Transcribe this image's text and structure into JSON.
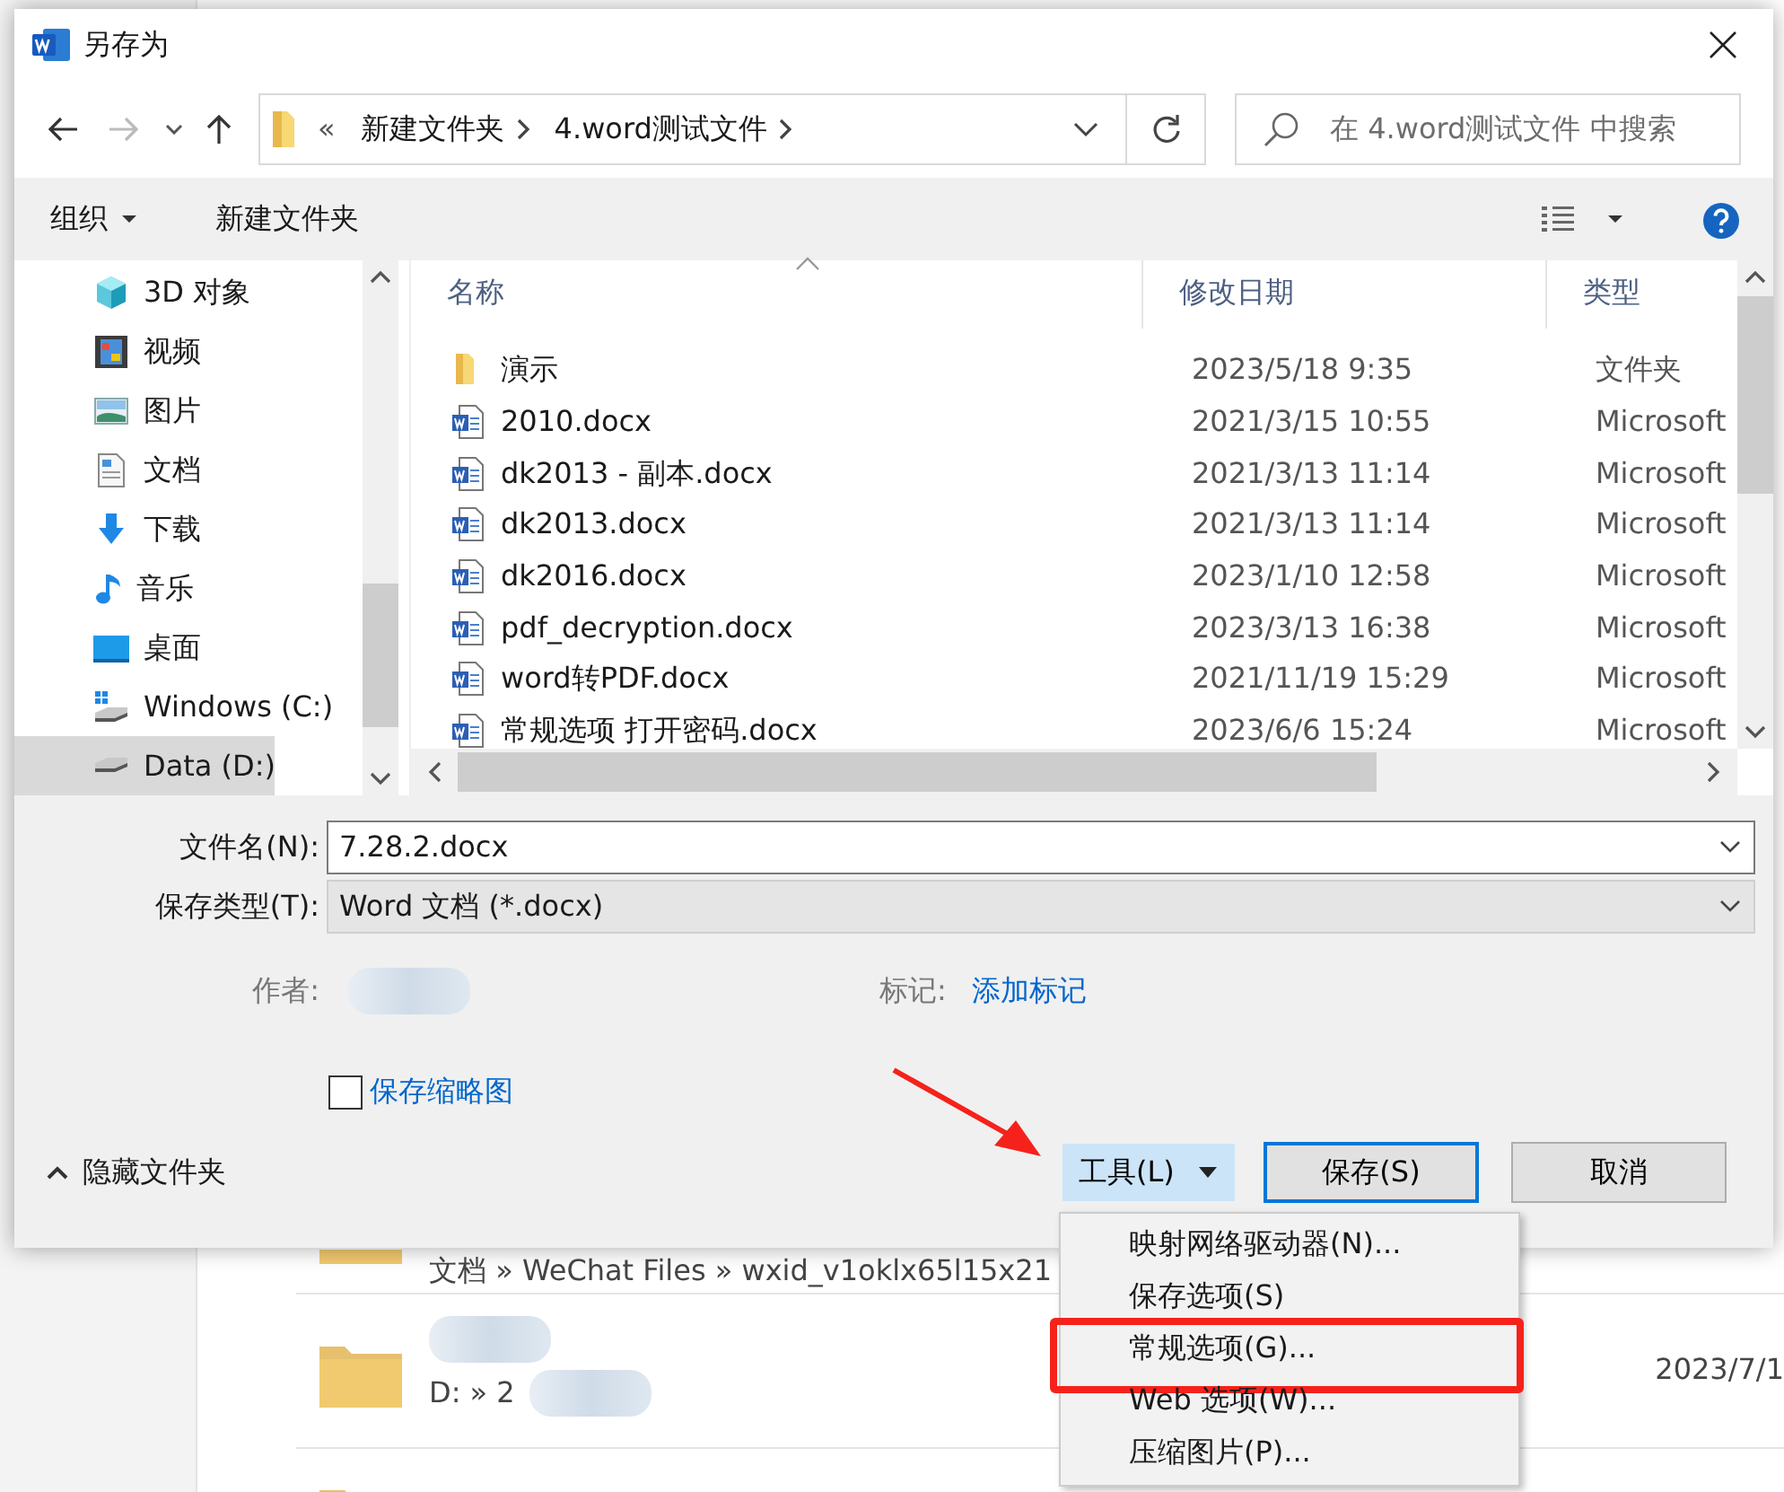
{
  "background": {
    "rows": [
      {
        "kind": "path",
        "path": "文档 » WeChat Files » wxid_v1oklx65l15x21"
      },
      {
        "kind": "folder",
        "path": "D: » 2",
        "date": "2023/7/1"
      },
      {
        "kind": "folder"
      }
    ]
  },
  "dialog": {
    "title": "另存为",
    "address": {
      "overflow": "«",
      "crumbs": [
        "新建文件夹",
        "4.word测试文件"
      ]
    },
    "search": {
      "placeholder": "在 4.word测试文件 中搜索"
    },
    "toolbar": {
      "organize": "组织",
      "new_folder": "新建文件夹"
    },
    "nav_items": [
      {
        "label": "3D 对象",
        "selected": false
      },
      {
        "label": "视频",
        "selected": false
      },
      {
        "label": "图片",
        "selected": false
      },
      {
        "label": "文档",
        "selected": false
      },
      {
        "label": "下载",
        "selected": false
      },
      {
        "label": "音乐",
        "selected": false
      },
      {
        "label": "桌面",
        "selected": false
      },
      {
        "label": "Windows (C:)",
        "selected": false
      },
      {
        "label": "Data (D:)",
        "selected": true
      }
    ],
    "columns": [
      "名称",
      "修改日期",
      "类型"
    ],
    "files": [
      {
        "kind": "folder",
        "name": "演示",
        "date": "2023/5/18 9:35",
        "type": "文件夹"
      },
      {
        "kind": "docx",
        "name": "2010.docx",
        "date": "2021/3/15 10:55",
        "type": "Microsoft"
      },
      {
        "kind": "docx",
        "name": "dk2013 - 副本.docx",
        "date": "2021/3/13 11:14",
        "type": "Microsoft"
      },
      {
        "kind": "docx",
        "name": "dk2013.docx",
        "date": "2021/3/13 11:14",
        "type": "Microsoft"
      },
      {
        "kind": "docx",
        "name": "dk2016.docx",
        "date": "2023/1/10 12:58",
        "type": "Microsoft"
      },
      {
        "kind": "docx",
        "name": "pdf_decryption.docx",
        "date": "2023/3/13 16:38",
        "type": "Microsoft"
      },
      {
        "kind": "docx",
        "name": "word转PDF.docx",
        "date": "2021/11/19 15:29",
        "type": "Microsoft"
      },
      {
        "kind": "docx",
        "name": "常规选项 打开密码.docx",
        "date": "2023/6/6 15:24",
        "type": "Microsoft"
      }
    ],
    "filename": {
      "label": "文件名(N):",
      "value": "7.28.2.docx"
    },
    "filetype": {
      "label": "保存类型(T):",
      "value": "Word 文档 (*.docx)"
    },
    "author": {
      "label": "作者:"
    },
    "tags": {
      "label": "标记:",
      "value": "添加标记"
    },
    "thumbnail": {
      "label": "保存缩略图",
      "checked": false
    },
    "hide_folders": "隐藏文件夹",
    "buttons": {
      "tools": "工具(L)",
      "save": "保存(S)",
      "cancel": "取消"
    }
  },
  "tools_menu": [
    {
      "label": "映射网络驱动器(N)...",
      "marked": false
    },
    {
      "label": "保存选项(S)",
      "marked": false
    },
    {
      "label": "常规选项(G)...",
      "marked": true
    },
    {
      "label": "Web 选项(W)...",
      "marked": false
    },
    {
      "label": "压缩图片(P)...",
      "marked": false
    }
  ],
  "annotations": [
    {
      "kind": "arrow"
    }
  ]
}
